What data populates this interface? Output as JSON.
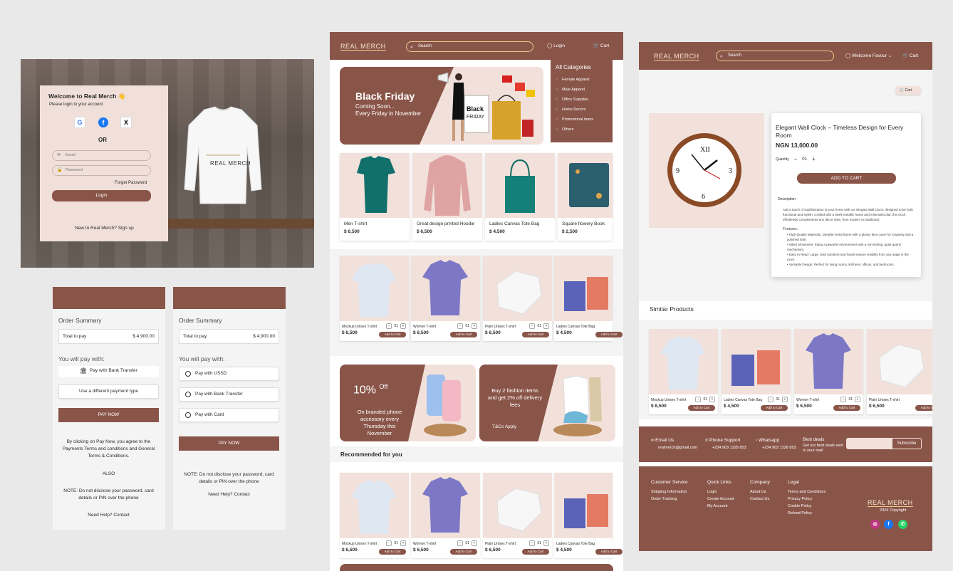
{
  "colors": {
    "brand": "#8a5549",
    "pink": "#f2e1db",
    "gold": "#e9c98a"
  },
  "login": {
    "title": "Welcome to Real Merch 👋",
    "subtitle": "Please login to your account",
    "social": [
      "G",
      "f",
      "X"
    ],
    "or": "OR",
    "email_placeholder": "Email",
    "password_placeholder": "Password",
    "forget": "Forget Password",
    "login_button": "Login",
    "new_to": "New to Real Merch?",
    "sign_up": "Sign up",
    "sweatshirt_brand": "REAL MERCH"
  },
  "pay1": {
    "order_summary": "Order Summary",
    "total_label": "Total to pay",
    "total_value": "$ 4,900.00",
    "you_will_pay": "You will pay with:",
    "bank_option": "Pay with Bank Transfer",
    "different": "Use a different payment type",
    "pay_now": "PAY NOW",
    "terms": "By clicking on Pay Now, you agree to the Payments Terms and conditions and General Terms & Conditions.",
    "also": "ALSO",
    "note": "NOTE: Do not disclose your password, card details or PIN over the phone",
    "help": "Need Help?",
    "contact": "Contact"
  },
  "pay2": {
    "order_summary": "Order Summary",
    "total_label": "Total to pay",
    "total_value": "$ 4,900.00",
    "you_will_pay": "You will pay with:",
    "options": [
      "Pay with USSD",
      "Pay with Bank Transfer",
      "Pay with Card"
    ],
    "pay_now": "PAY NOW",
    "note": "NOTE: Do not disclose your password, card details or PIN over the phone",
    "help": "Need Help?",
    "contact": "Contact"
  },
  "home": {
    "logo": "REAL MERCH",
    "search": "Search",
    "login": "Login",
    "cart": "Cart",
    "hero_title": "Black Friday",
    "hero_line1": "Coming Soon...",
    "hero_line2": "Every Friday in November",
    "categories_title": "All Categories",
    "categories": [
      "Female Apparel",
      "Male Apparel",
      "Office Supplies",
      "Home Decors",
      "Promotional items",
      "Others"
    ],
    "featured": [
      {
        "name": "Men T-shirt",
        "price": "$ 6,500"
      },
      {
        "name": "Great design printed Hoodie",
        "price": "$ 6,500"
      },
      {
        "name": "Ladies Canvas Tote Bag",
        "price": "$ 4,500"
      },
      {
        "name": "Square flowery Book",
        "price": "$ 2,500"
      }
    ],
    "row2": [
      {
        "name": "Mockup Unisex T-shirt",
        "price": "$ 6,500",
        "qty": "01",
        "atc": "Add to Cart"
      },
      {
        "name": "Women T-shirt",
        "price": "$ 6,500",
        "qty": "01",
        "atc": "Add to Cart"
      },
      {
        "name": "Plain Unisex T-shirt",
        "price": "$ 6,500",
        "qty": "01",
        "atc": "Add to Cart"
      },
      {
        "name": "Ladies Canvas Tote Bag",
        "price": "$ 4,500",
        "qty": "01",
        "atc": "Add to Cart"
      }
    ],
    "promo1_big": "10%",
    "promo1_off": "Off",
    "promo1_text": "On branded phone accessory every Thursday this November",
    "promo2_text": "Buy 2 fashion items and get 2% off delivery fees",
    "promo2_tc": "T&Cs Apply",
    "recommended": "Recommended for you",
    "row3": [
      {
        "name": "Mockup Unisex T-shirt",
        "price": "$ 6,500",
        "qty": "01",
        "atc": "Add to Cart"
      },
      {
        "name": "Women T-shirt",
        "price": "$ 6,500",
        "qty": "01",
        "atc": "Add to Cart"
      },
      {
        "name": "Plain Unisex T-shirt",
        "price": "$ 6,500",
        "qty": "01",
        "atc": "Add to Cart"
      },
      {
        "name": "Ladies Canvas Tote Bag",
        "price": "$ 4,500",
        "qty": "01",
        "atc": "Add to Cart"
      }
    ]
  },
  "product": {
    "logo": "REAL MERCH",
    "search": "Search",
    "welcome": "Welcome Favour",
    "cart": "Cart",
    "cart_chip": "Cart",
    "title": "Elegant Wall Clock – Timeless Design for Every Room",
    "price": "NGN 13,000.00",
    "quantity_label": "Quantity",
    "qty": "01",
    "add_to_cart": "ADD TO CART",
    "description_label": "Description",
    "description": "Add a touch of sophistication to your home with our Elegant Wall Clock, designed to be both functional and stylish. Crafted with a sleek metallic frame and minimalist dial, this clock effortlessly complements any décor style, from modern to traditional.",
    "features_label": "Features:",
    "features": [
      "High-Quality Materials: Durable metal frame with a glossy face cover for longevity and a polished look.",
      "Silent Movement: Enjoy a peaceful environment with a non-ticking, quiet quartz mechanism.",
      "Easy to Read: Large, bold numbers and hands ensure visibility from any angle in the room.",
      "Versatile Design: Perfect for living rooms, kitchens, offices, and bedrooms."
    ],
    "similar": "Similar Products",
    "similar_items": [
      {
        "name": "Mockup Unisex T-shirt",
        "price": "$ 6,500",
        "qty": "01",
        "atc": "Add to Cart"
      },
      {
        "name": "Ladies Canvas Tote Bag",
        "price": "$ 4,500",
        "qty": "01",
        "atc": "Add to Cart"
      },
      {
        "name": "Women T-shirt",
        "price": "$ 6,500",
        "qty": "01",
        "atc": "Add to Cart"
      },
      {
        "name": "Plain Unisex T-shirt",
        "price": "$ 6,500",
        "qty": "01",
        "atc": "Add to Cart"
      }
    ],
    "email_label": "Email Us",
    "email_value": "realmerch@gmail.com",
    "phone_label": "Phone Support",
    "phone_value": "+234 903 1328 853",
    "whatsapp_label": "Whatsapp",
    "whatsapp_value": "+234 903 1328 853",
    "deals_label": "Best deals",
    "deals_value": "Get our best deals sent to your mail",
    "subscribe": "Subscribe",
    "cs_title": "Customer Service",
    "cs_items": [
      "Shipping Information",
      "Order Tracking"
    ],
    "ql_title": "Quick Links",
    "ql_items": [
      "Login",
      "Create Account",
      "My Account"
    ],
    "co_title": "Company",
    "co_items": [
      "About Us",
      "Contact Us"
    ],
    "legal_title": "Legal",
    "legal_items": [
      "Terms and Conditions",
      "Privacy Policy",
      "Cookie Policy",
      "Refund Policy"
    ],
    "copyright": "2024 Copyright"
  }
}
